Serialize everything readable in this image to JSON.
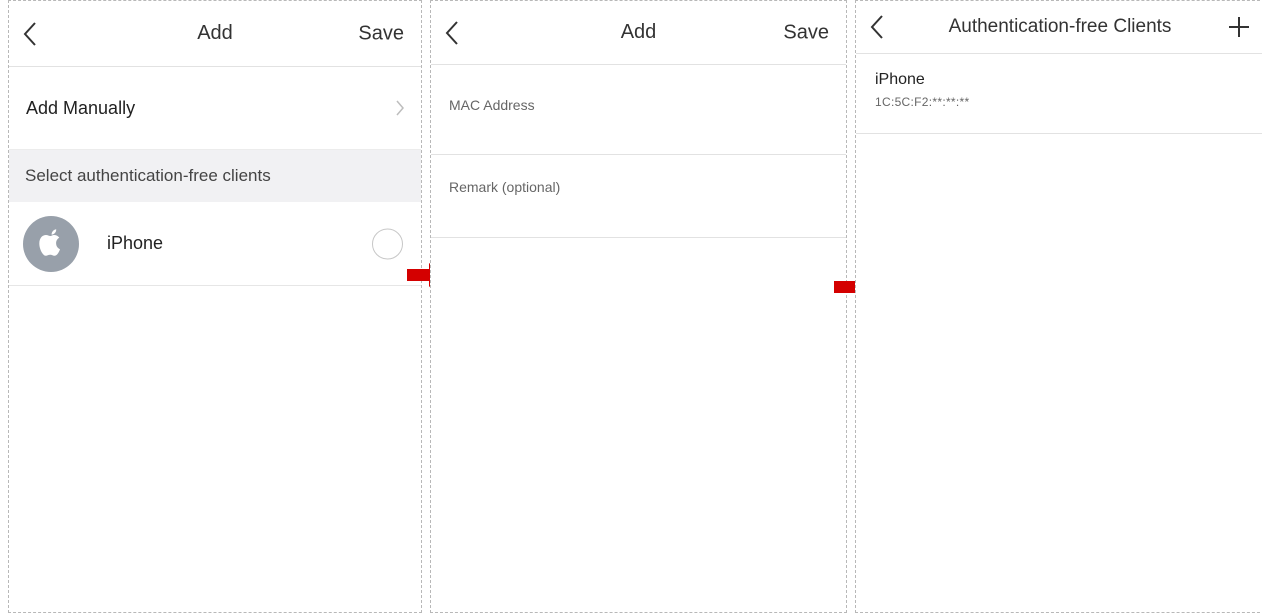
{
  "screen1": {
    "title": "Add",
    "save_label": "Save",
    "add_manually_label": "Add Manually",
    "section_header": "Select authentication-free clients",
    "clients": [
      {
        "name": "iPhone",
        "icon": "apple-icon",
        "selected": false
      }
    ]
  },
  "screen2": {
    "title": "Add",
    "save_label": "Save",
    "mac_placeholder": "MAC Address",
    "remark_placeholder": "Remark (optional)"
  },
  "screen3": {
    "title": "Authentication-free Clients",
    "clients": [
      {
        "name": "iPhone",
        "mac": "1C:5C:F2:**:**:**"
      }
    ]
  },
  "colors": {
    "flow_arrow": "#d40000",
    "avatar_bg": "#98a0aa",
    "section_bg": "#f1f1f3"
  }
}
